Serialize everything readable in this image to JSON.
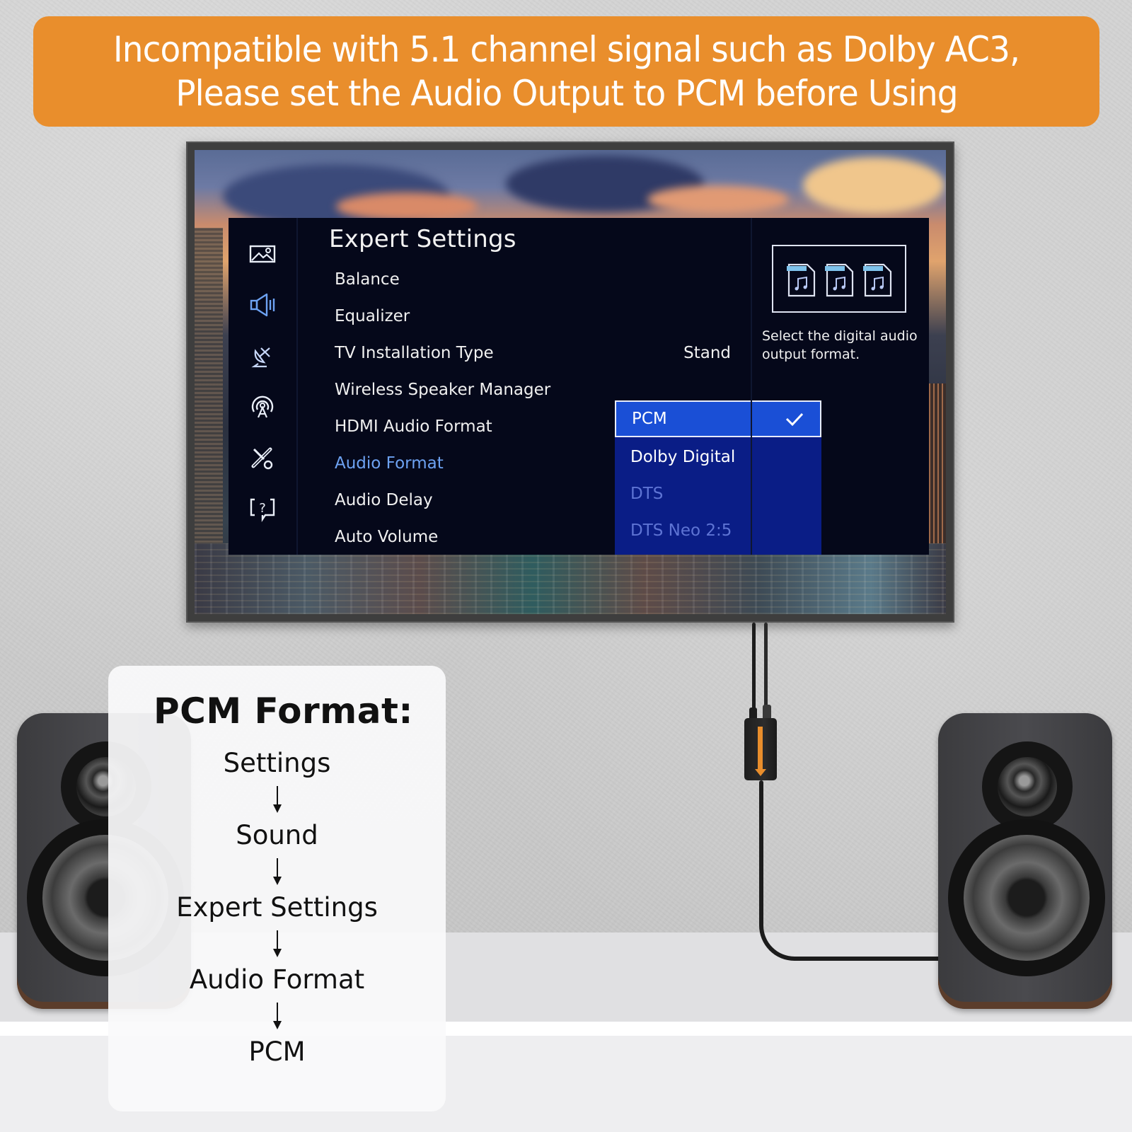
{
  "banner": {
    "line1": "Incompatible with 5.1 channel signal such as Dolby AC3,",
    "line2": "Please set the Audio Output to PCM before Using",
    "color": "#e98e2c"
  },
  "tv_menu": {
    "title": "Expert Settings",
    "rail_icons": [
      "picture-icon",
      "sound-icon",
      "broadcasting-icon",
      "network-icon",
      "support-tools-icon",
      "help-icon"
    ],
    "items": [
      {
        "label": "Balance",
        "value": null
      },
      {
        "label": "Equalizer",
        "value": null
      },
      {
        "label": "TV Installation Type",
        "value": "Stand"
      },
      {
        "label": "Wireless Speaker Manager",
        "value": null
      },
      {
        "label": "HDMI Audio Format",
        "value": null
      },
      {
        "label": "Audio Format",
        "value": null,
        "active": true
      },
      {
        "label": "Audio Delay",
        "value": null
      },
      {
        "label": "Auto Volume",
        "value": null
      }
    ],
    "dropdown": {
      "options": [
        {
          "label": "PCM",
          "state": "selected"
        },
        {
          "label": "Dolby Digital",
          "state": "enabled"
        },
        {
          "label": "DTS",
          "state": "disabled"
        },
        {
          "label": "DTS Neo 2:5",
          "state": "disabled"
        }
      ],
      "selected_color": "#1a4fd6"
    },
    "side_panel": {
      "description": "Select the digital audio output format.",
      "file_icons": [
        "audio-file-icon",
        "audio-file-icon",
        "audio-file-icon"
      ]
    }
  },
  "pcm_card": {
    "title": "PCM Format:",
    "steps": [
      "Settings",
      "Sound",
      "Expert Settings",
      "Audio Format",
      "PCM"
    ]
  }
}
